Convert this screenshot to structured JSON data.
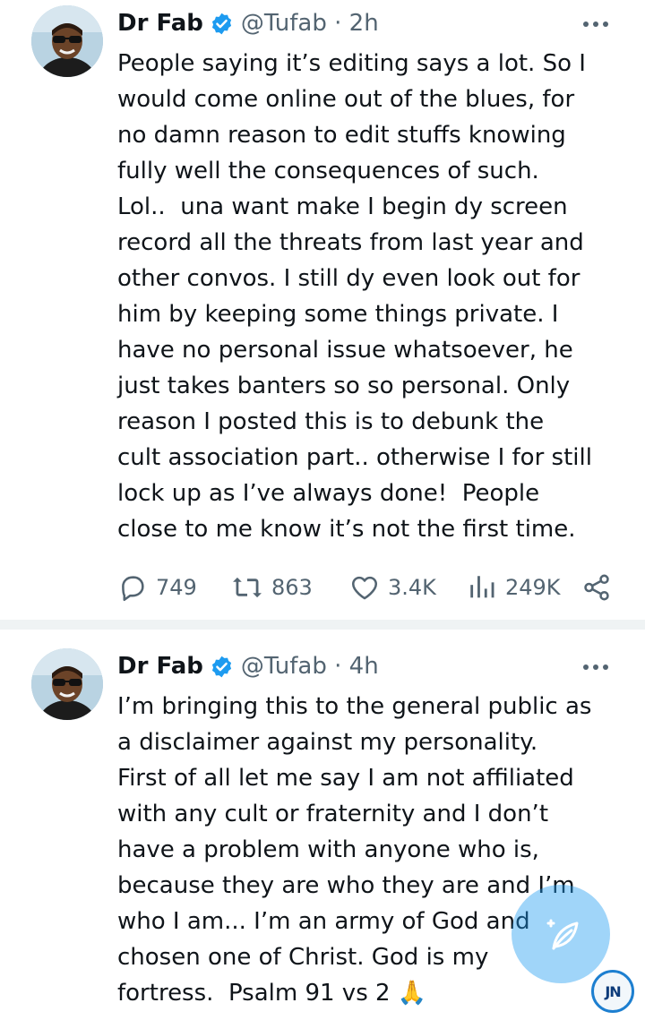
{
  "tweets": [
    {
      "author_name": "Dr Fab",
      "handle_time": "@Tufab · 2h",
      "text": "People saying it’s editing says a lot. So I\nwould come online out of the blues, for\nno damn reason to edit stuffs knowing\nfully well the consequences of such.\nLol..  una want make I begin dy screen\nrecord all the threats from last year and\nother convos. I still dy even look out for\nhim by keeping some things private. I\nhave no personal issue whatsoever, he\njust takes banters so so personal. Only\nreason I posted this is to debunk the\ncult association part.. otherwise I for still\nlock up as I’ve always done!  People\nclose to me know it’s not the first time.",
      "stats": {
        "replies": "749",
        "reposts": "863",
        "likes": "3.4K",
        "views": "249K"
      }
    },
    {
      "author_name": "Dr Fab",
      "handle_time": "@Tufab · 4h",
      "text": "I’m bringing this to the general public as\na disclaimer against my personality.\nFirst of all let me say I am not affiliated\nwith any cult or fraternity and I don’t\nhave a problem with anyone who is,\nbecause they are who they are and I’m\nwho I am... I’m an army of God and\nchosen one of Christ. God is my\nfortress.  Psalm 91 vs 2 🙏"
    }
  ],
  "watermark": "JN",
  "colors": {
    "accent": "#1d9bf0",
    "secondary_text": "#536471",
    "separator": "#eff3f4"
  },
  "icons": [
    "verified-badge-icon",
    "more-icon",
    "reply-icon",
    "repost-icon",
    "like-icon",
    "views-icon",
    "share-icon",
    "compose-icon"
  ]
}
